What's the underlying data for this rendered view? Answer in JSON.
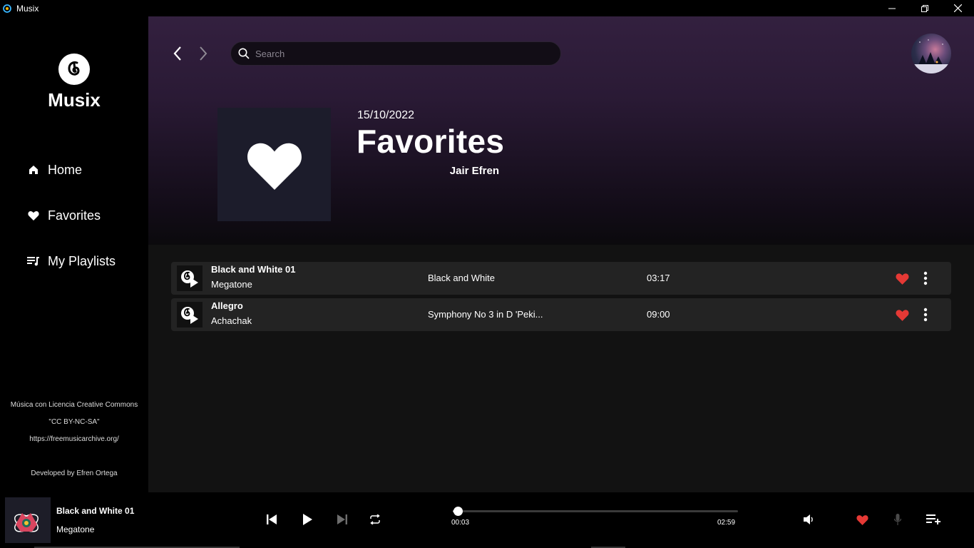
{
  "window": {
    "title": "Musix"
  },
  "sidebar": {
    "brand": "Musix",
    "items": [
      {
        "label": "Home",
        "icon": "home-icon"
      },
      {
        "label": "Favorites",
        "icon": "heart-icon"
      },
      {
        "label": "My Playlists",
        "icon": "playlist-icon"
      }
    ],
    "credits": {
      "line1": "Música con Licencia Creative Commons",
      "line2": "\"CC BY-NC-SA\"",
      "line3": "https://freemusicarchive.org/",
      "developer": "Developed by Efren Ortega"
    }
  },
  "header": {
    "search_placeholder": "Search"
  },
  "playlist": {
    "date": "15/10/2022",
    "title": "Favorites",
    "owner": "Jair Efren"
  },
  "tracks": [
    {
      "title": "Black and White 01",
      "artist": "Megatone",
      "album": "Black and White",
      "duration": "03:17",
      "liked": true
    },
    {
      "title": "Allegro",
      "artist": "Achachak",
      "album": "Symphony No 3 in D 'Peki...",
      "duration": "09:00",
      "liked": true
    }
  ],
  "player": {
    "title": "Black and White 01",
    "artist": "Megatone",
    "current_time": "00:03",
    "total_time": "02:59",
    "progress": 0.017,
    "liked": true
  },
  "colors": {
    "accent_heart": "#e53935",
    "hero_top": "#33203f",
    "background": "#121212",
    "track_row": "#232323"
  }
}
